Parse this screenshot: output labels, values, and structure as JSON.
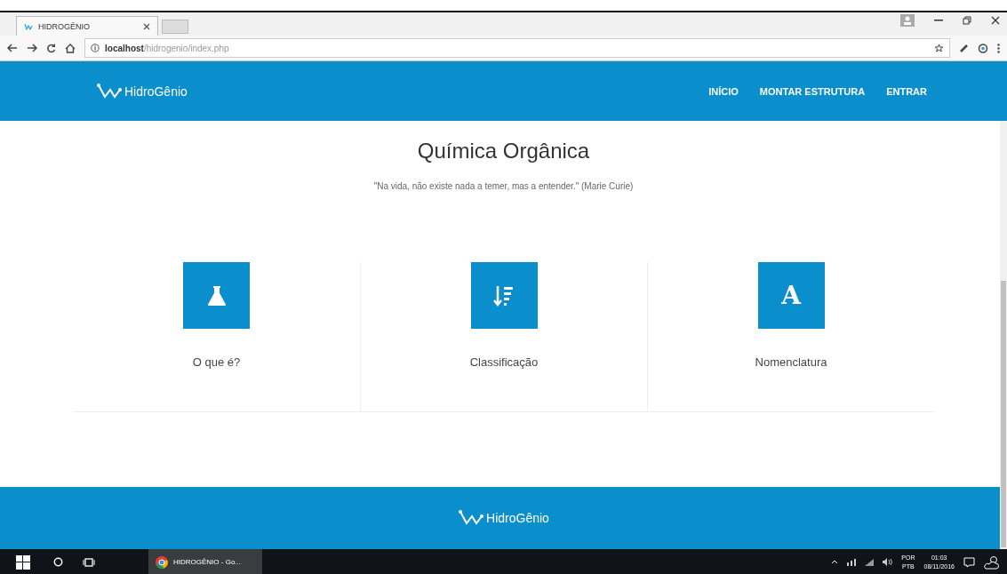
{
  "browser": {
    "tab": {
      "title": "HIDROGÊNIO",
      "selected": true
    },
    "url_host": "localhost",
    "url_path": "/hidrogenio/index.php"
  },
  "header": {
    "logo": "HidroGênio",
    "nav": [
      {
        "label": "INÍCIO"
      },
      {
        "label": "MONTAR ESTRUTURA"
      },
      {
        "label": "ENTRAR"
      }
    ]
  },
  "title": "Química Orgânica",
  "quote": "\"Na vida, não existe nada a temer, mas a entender.\" (Marie Curie)",
  "cards": [
    {
      "kind": "flask",
      "label": "O que é?"
    },
    {
      "kind": "sort",
      "label": "Classificação"
    },
    {
      "kind": "letter",
      "icon_text": "A",
      "label": "Nomenclatura"
    }
  ],
  "footer": {
    "logo": "HidroGênio"
  },
  "taskbar": {
    "app": "HIDROGÊNIO - Go...",
    "lang_top": "POR",
    "lang_bottom": "PTB",
    "time": "01:03",
    "date": "08/11/2016"
  }
}
